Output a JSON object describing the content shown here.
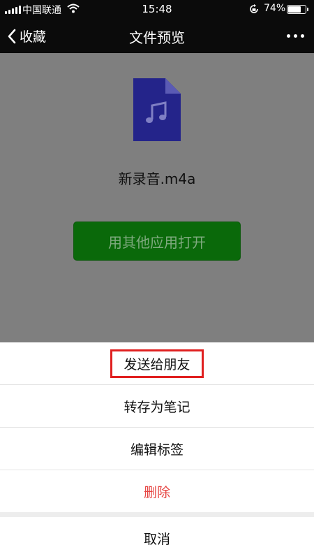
{
  "status_bar": {
    "carrier": "中国联通",
    "time": "15:48",
    "battery": "74%",
    "battery_level": 0.74,
    "icons": [
      "signal-icon",
      "wifi-icon",
      "orientation-lock-icon",
      "battery-icon"
    ]
  },
  "nav": {
    "back_label": "收藏",
    "title": "文件预览",
    "more_icon": "more-dots-icon"
  },
  "preview": {
    "file_icon": "music-file-icon",
    "file_name": "新录音.m4a",
    "open_button": "用其他应用打开"
  },
  "action_sheet": {
    "items": [
      {
        "label": "发送给朋友"
      },
      {
        "label": "转存为笔记"
      },
      {
        "label": "编辑标签"
      },
      {
        "label": "删除"
      }
    ],
    "cancel": "取消"
  },
  "colors": {
    "bar": "#0b0b0b",
    "open_button": "#0a690a",
    "danger": "#e64340",
    "highlight": "#e02020"
  }
}
